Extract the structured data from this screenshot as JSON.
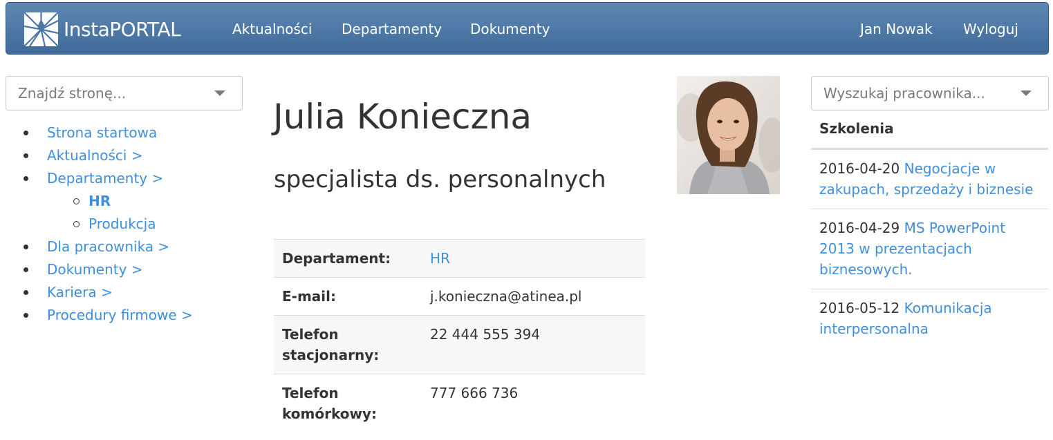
{
  "navbar": {
    "brand": "InstaPORTAL",
    "links": [
      "Aktualności",
      "Departamenty",
      "Dokumenty"
    ],
    "user": "Jan Nowak",
    "logout": "Wyloguj"
  },
  "left_sidebar": {
    "search_placeholder": "Znajdź stronę...",
    "menu": [
      {
        "label": "Strona startowa"
      },
      {
        "label": "Aktualności >"
      },
      {
        "label": "Departamenty >"
      },
      {
        "label": "HR"
      },
      {
        "label": "Produkcja"
      },
      {
        "label": "Dla pracownika >"
      },
      {
        "label": "Dokumenty >"
      },
      {
        "label": "Kariera >"
      },
      {
        "label": "Procedury firmowe >"
      }
    ]
  },
  "profile": {
    "name": "Julia Konieczna",
    "role": "specjalista ds. personalnych",
    "details": [
      {
        "label": "Departament:",
        "value": "HR"
      },
      {
        "label": "E-mail:",
        "value": "j.konieczna@atinea.pl"
      },
      {
        "label": "Telefon stacjonarny:",
        "value": "22 444 555 394"
      },
      {
        "label": "Telefon komórkowy:",
        "value": "777 666 736"
      }
    ]
  },
  "right_sidebar": {
    "search_placeholder": "Wyszukaj pracownika...",
    "trainings_title": "Szkolenia",
    "trainings": [
      {
        "date": "2016-04-20",
        "title": "Negocjacje w zakupach, sprzedaży i biznesie"
      },
      {
        "date": "2016-04-29",
        "title": "MS PowerPoint 2013 w prezentacjach biznesowych."
      },
      {
        "date": "2016-05-12",
        "title": "Komunikacja interpersonalna"
      }
    ]
  }
}
